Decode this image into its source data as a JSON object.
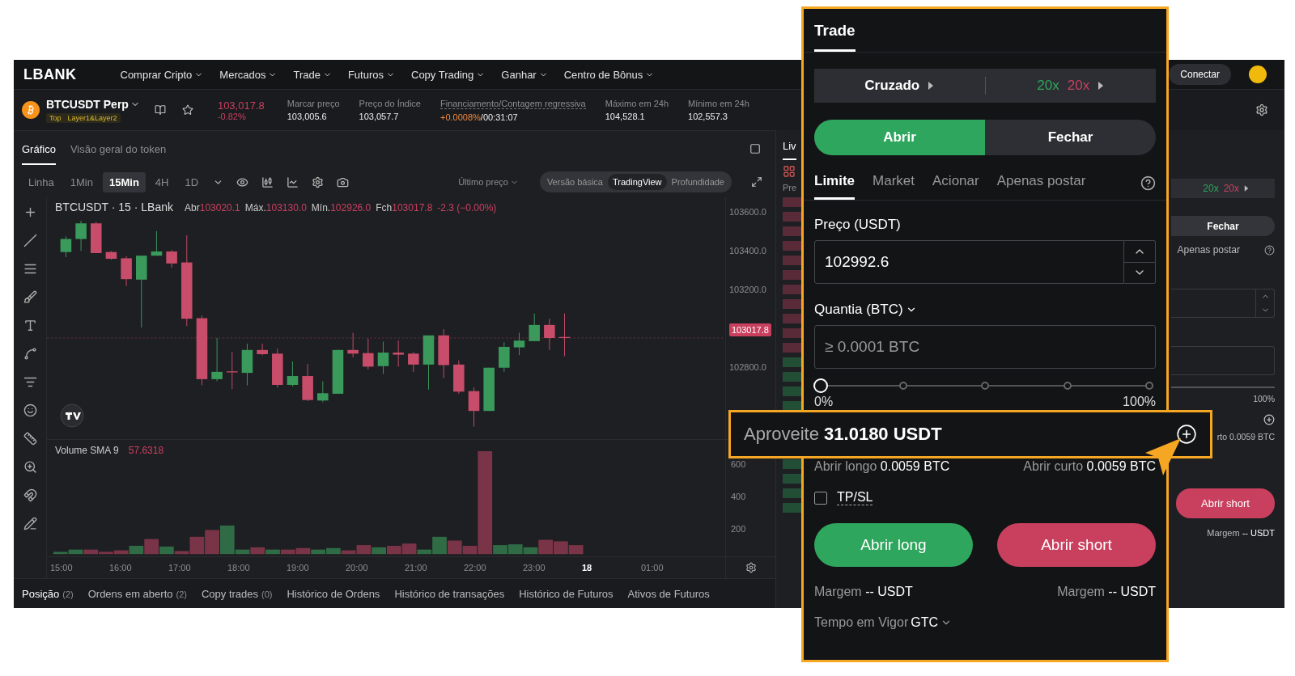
{
  "nav": {
    "logo": "LBANK",
    "items": [
      {
        "label": "Comprar Cripto"
      },
      {
        "label": "Mercados"
      },
      {
        "label": "Trade"
      },
      {
        "label": "Futuros"
      },
      {
        "label": "Copy Trading"
      },
      {
        "label": "Ganhar"
      },
      {
        "label": "Centro de Bônus"
      }
    ],
    "connect": "Conectar"
  },
  "ticker": {
    "symbol": "BTCUSDT Perp",
    "tags": [
      "Top",
      "Layer1&Layer2"
    ],
    "price": "103,017.8",
    "change": "-0.82%",
    "stats": [
      {
        "label": "Marcar preço",
        "value": "103,005.6",
        "kind": "plain"
      },
      {
        "label": "Preço do Índice",
        "value": "103,057.7",
        "kind": "plain"
      },
      {
        "label": "Financiamento/Contagem regressiva",
        "value": "+0.0008%",
        "countdown": "/00:31:07",
        "kind": "funding"
      },
      {
        "label": "Máximo em 24h",
        "value": "104,528.1",
        "kind": "plain"
      },
      {
        "label": "Mínimo em 24h",
        "value": "102,557.3",
        "kind": "plain"
      }
    ]
  },
  "chart_tabs": [
    {
      "label": "Gráfico",
      "selected": true
    },
    {
      "label": "Visão geral do token",
      "selected": false
    }
  ],
  "intervals": [
    {
      "label": "Linha",
      "selected": false
    },
    {
      "label": "1Min",
      "selected": false
    },
    {
      "label": "15Min",
      "selected": true
    },
    {
      "label": "4H",
      "selected": false
    },
    {
      "label": "1D",
      "selected": false
    }
  ],
  "price_source": "Último preço",
  "views": [
    {
      "label": "Versão básica",
      "selected": false
    },
    {
      "label": "TradingView",
      "selected": true
    },
    {
      "label": "Profundidade",
      "selected": false
    }
  ],
  "legend": {
    "title": "BTCUSDT · 15 · LBank",
    "ohlc": [
      {
        "label": "Abr",
        "value": "103020.1"
      },
      {
        "label": "Máx.",
        "value": "103130.0"
      },
      {
        "label": "Mín.",
        "value": "102926.0"
      },
      {
        "label": "Fch",
        "value": "103017.8"
      }
    ],
    "change": "-2.3 (−0.00%)"
  },
  "price_axis": [
    "103600.0",
    "103400.0",
    "103200.0",
    "102800.0"
  ],
  "last_price": "103017.8",
  "volume": {
    "title": "Volume SMA 9",
    "value": "57.6318",
    "axis": [
      "600",
      "400",
      "200"
    ]
  },
  "time_axis": [
    {
      "label": "15:00",
      "kind": "time"
    },
    {
      "label": "16:00",
      "kind": "time"
    },
    {
      "label": "17:00",
      "kind": "time"
    },
    {
      "label": "18:00",
      "kind": "time"
    },
    {
      "label": "19:00",
      "kind": "time"
    },
    {
      "label": "20:00",
      "kind": "time"
    },
    {
      "label": "21:00",
      "kind": "time"
    },
    {
      "label": "22:00",
      "kind": "time"
    },
    {
      "label": "23:00",
      "kind": "time"
    },
    {
      "label": "18",
      "kind": "day"
    },
    {
      "label": "01:00",
      "kind": "time"
    }
  ],
  "bottom_tabs": [
    {
      "label": "Posição",
      "count": "(2)",
      "selected": true
    },
    {
      "label": "Ordens em aberto",
      "count": "(2)",
      "selected": false
    },
    {
      "label": "Copy trades",
      "count": "(0)",
      "selected": false
    },
    {
      "label": "Histórico de Ordens",
      "selected": false
    },
    {
      "label": "Histórico de transações",
      "selected": false
    },
    {
      "label": "Histórico de Futuros",
      "selected": false
    },
    {
      "label": "Ativos de Futuros",
      "selected": false
    }
  ],
  "background_panel": {
    "book_tab": "Liv",
    "book_header": "Pre",
    "leverage": [
      "20x",
      "20x"
    ],
    "close": "Fechar",
    "post_only": "Apenas postar",
    "percent": "100%",
    "order_size": "rto 0.0059 BTC",
    "short": "Abrir short",
    "margin": {
      "label": "Margem",
      "value": "--",
      "unit": "USDT"
    }
  },
  "trade": {
    "title": "Trade",
    "margin_mode": "Cruzado",
    "leverage": [
      {
        "value": "20x",
        "color": "#2ea65d"
      },
      {
        "value": "20x",
        "color": "#c9405f"
      }
    ],
    "actions": [
      {
        "label": "Abrir",
        "selected": true
      },
      {
        "label": "Fechar",
        "selected": false
      }
    ],
    "order_types": [
      {
        "label": "Limite",
        "selected": true
      },
      {
        "label": "Market",
        "selected": false
      },
      {
        "label": "Acionar",
        "selected": false
      },
      {
        "label": "Apenas postar",
        "selected": false
      }
    ],
    "price": {
      "label": "Preço (USDT)",
      "value": "102992.6"
    },
    "quantity": {
      "label": "Quantia (BTC)",
      "placeholder": "≥ 0.0001 BTC"
    },
    "slider": {
      "level": 0,
      "min_label": "0%",
      "max_label": "100%"
    },
    "sizes": [
      {
        "label": "Abrir longo",
        "value": "0.0059 BTC"
      },
      {
        "label": "Abrir curto",
        "value": "0.0059 BTC"
      }
    ],
    "tpsl": {
      "label": "TP/SL",
      "checked": false
    },
    "buttons": [
      {
        "label": "Abrir long",
        "color": "#2ea65d"
      },
      {
        "label": "Abrir short",
        "color": "#c9405f"
      }
    ],
    "margins": [
      {
        "label": "Margem",
        "value": "--",
        "unit": "USDT"
      },
      {
        "label": "Margem",
        "value": "--",
        "unit": "USDT"
      }
    ],
    "time_in_force": {
      "label": "Tempo em Vigor",
      "value": "GTC"
    }
  },
  "callout": {
    "label": "Aproveite",
    "value": "31.0180 USDT"
  }
}
